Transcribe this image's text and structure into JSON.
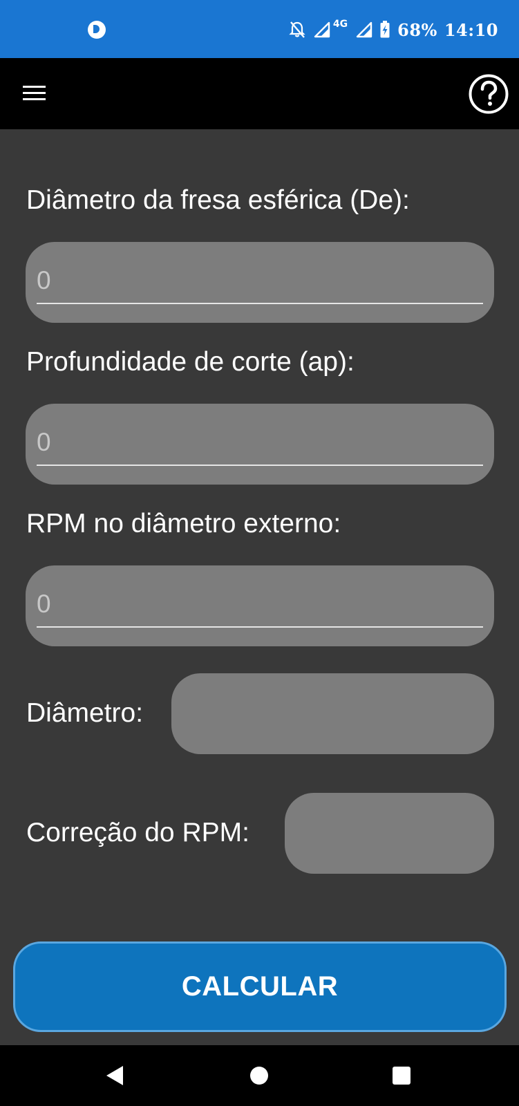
{
  "status_bar": {
    "battery": "68%",
    "time": "14:10",
    "network": "4G"
  },
  "app_bar": {
    "menu_icon": "hamburger-menu-icon",
    "help_icon": "help-circle-icon"
  },
  "form": {
    "de_label": "Diâmetro da fresa esférica (De):",
    "de_placeholder": "0",
    "ap_label": "Profundidade de corte (ap):",
    "ap_placeholder": "0",
    "rpm_label": "RPM no diâmetro externo:",
    "rpm_placeholder": "0",
    "diameter_label": "Diâmetro:",
    "diameter_value": "",
    "rpm_correction_label": "Correção do RPM:",
    "rpm_correction_value": ""
  },
  "calc_button": {
    "label": "CALCULAR"
  },
  "nav_bar": {
    "back_icon": "back-triangle-icon",
    "home_icon": "home-circle-icon",
    "recents_icon": "recents-square-icon"
  },
  "colors": {
    "status_bar": "#1a76d2",
    "background": "#393939",
    "field": "#7d7d7d",
    "button": "#0e74bd",
    "button_border": "#5aa7e0"
  }
}
